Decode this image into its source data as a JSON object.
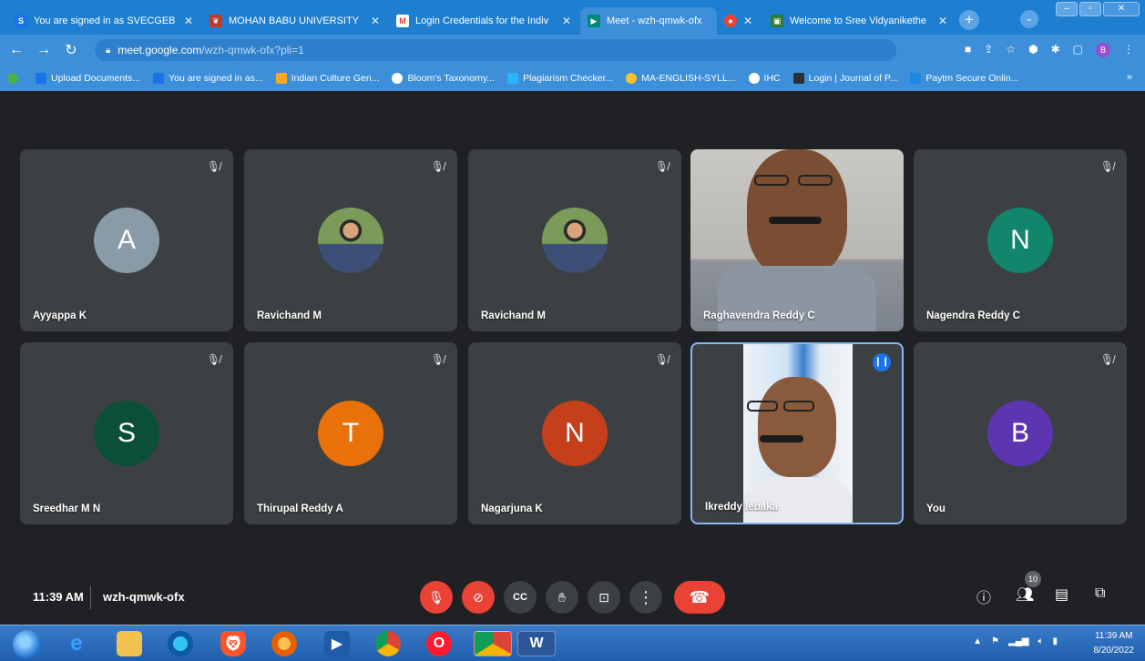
{
  "browser": {
    "tabs": [
      {
        "title": "You are signed in as SVECGEB",
        "favicon": "S",
        "favicon_color": "#1a73e8"
      },
      {
        "title": "MOHAN BABU UNIVERSITY",
        "favicon": "MB",
        "favicon_color": "#c0392b"
      },
      {
        "title": "Login Credentials for the Indiv",
        "favicon": "M",
        "favicon_color": "#ea4335"
      },
      {
        "title": "Meet - wzh-qmwk-ofx",
        "favicon": "",
        "favicon_color": "#00897b"
      },
      {
        "title": "",
        "favicon": "",
        "favicon_color": "#ea4335"
      },
      {
        "title": "Welcome to Sree Vidyanikethe",
        "favicon": "",
        "favicon_color": "#2e7d32"
      }
    ],
    "url_host": "meet.google.com",
    "url_path": "/wzh-qmwk-ofx?pli=1",
    "bookmarks": [
      {
        "label": "Upload Documents...",
        "color": "#1a73e8"
      },
      {
        "label": "You are signed in as...",
        "color": "#1a73e8"
      },
      {
        "label": "Indian Culture Gen...",
        "color": "#f9a825"
      },
      {
        "label": "Bloom's Taxonomy...",
        "color": "#ffffff"
      },
      {
        "label": "Plagiarism Checker...",
        "color": "#29b6f6"
      },
      {
        "label": "MA-ENGLISH-SYLL...",
        "color": "#fbc02d"
      },
      {
        "label": "IHC",
        "color": "#ffffff"
      },
      {
        "label": "Login | Journal of P...",
        "color": "#263238"
      },
      {
        "label": "Paytm Secure Onlin...",
        "color": "#1e88e5"
      }
    ],
    "profile_initial": "B"
  },
  "participants": [
    {
      "name": "Ayyappa K",
      "initial": "A",
      "color": "#8a9ba8",
      "kind": "letter"
    },
    {
      "name": "Ravichand M",
      "initial": "",
      "color": "",
      "kind": "photo"
    },
    {
      "name": "Ravichand M",
      "initial": "",
      "color": "",
      "kind": "photo"
    },
    {
      "name": "Raghavendra Reddy C",
      "initial": "",
      "color": "",
      "kind": "video"
    },
    {
      "name": "Nagendra Reddy C",
      "initial": "N",
      "color": "#12866d",
      "kind": "letter"
    },
    {
      "name": "Sreedhar M N",
      "initial": "S",
      "color": "#0b4f36",
      "kind": "letter"
    },
    {
      "name": "Thirupal Reddy A",
      "initial": "T",
      "color": "#e8710a",
      "kind": "letter"
    },
    {
      "name": "Nagarjuna K",
      "initial": "N",
      "color": "#c5401a",
      "kind": "letter"
    },
    {
      "name": "Ikreddy lebaka",
      "initial": "",
      "color": "",
      "kind": "video"
    },
    {
      "name": "You",
      "initial": "B",
      "color": "#5e35b1",
      "kind": "letter"
    }
  ],
  "meeting": {
    "time": "11:39 AM",
    "code": "wzh-qmwk-ofx",
    "participant_count": "10"
  },
  "taskbar": {
    "time": "11:39 AM",
    "date": "8/20/2022"
  }
}
